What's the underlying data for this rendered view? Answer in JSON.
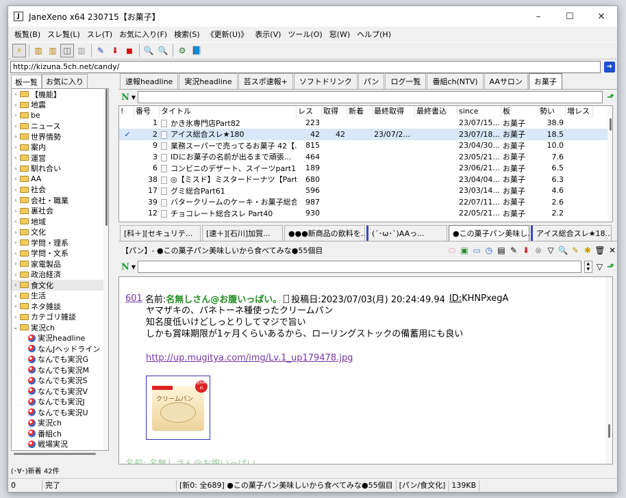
{
  "window": {
    "title": "JaneXeno x64 230715【お菓子】",
    "icon": "J"
  },
  "window_controls": {
    "minimize": "–",
    "maximize": "☐",
    "close": "✕"
  },
  "menu": [
    "板覧(B)",
    "スレ覧(L)",
    "スレ(T)",
    "お気に入り(F)",
    "検索(S)",
    "《更新(U)》",
    "表示(V)",
    "ツール(O)",
    "窓(W)",
    "ヘルプ(H)"
  ],
  "toolbar_icons": {
    "lightning": "⚡",
    "pane1": "▥",
    "pane2": "▥",
    "pane3": "◫",
    "pane4": "▥",
    "pen": "✎",
    "down": "⬇",
    "stop": "◼",
    "search1": "🔍",
    "search2": "🔍",
    "fav": "⚙",
    "book": "📘"
  },
  "url": "http://kizuna.5ch.net/candy/",
  "left_tabs": [
    "板一覧",
    "お気に入り"
  ],
  "tree": [
    {
      "label": "【機能】",
      "type": "folder",
      "arrow": "›"
    },
    {
      "label": "地震",
      "type": "folder",
      "arrow": "›"
    },
    {
      "label": "be",
      "type": "folder",
      "arrow": "›"
    },
    {
      "label": "ニュース",
      "type": "folder",
      "arrow": "›"
    },
    {
      "label": "世界情勢",
      "type": "folder",
      "arrow": "›"
    },
    {
      "label": "案内",
      "type": "folder",
      "arrow": "›"
    },
    {
      "label": "運営",
      "type": "folder",
      "arrow": "›"
    },
    {
      "label": "馴れ合い",
      "type": "folder",
      "arrow": "›"
    },
    {
      "label": "AA",
      "type": "folder",
      "arrow": "›"
    },
    {
      "label": "社会",
      "type": "folder",
      "arrow": "›"
    },
    {
      "label": "会社・職業",
      "type": "folder",
      "arrow": "›"
    },
    {
      "label": "裏社会",
      "type": "folder",
      "arrow": "›"
    },
    {
      "label": "地域",
      "type": "folder",
      "arrow": "›"
    },
    {
      "label": "文化",
      "type": "folder",
      "arrow": "›"
    },
    {
      "label": "学問・理系",
      "type": "folder",
      "arrow": "›"
    },
    {
      "label": "学問・文系",
      "type": "folder",
      "arrow": "›"
    },
    {
      "label": "家電製品",
      "type": "folder",
      "arrow": "›"
    },
    {
      "label": "政治経済",
      "type": "folder",
      "arrow": "›"
    },
    {
      "label": "食文化",
      "type": "folder",
      "arrow": "›",
      "selected": true
    },
    {
      "label": "生活",
      "type": "folder",
      "arrow": "›"
    },
    {
      "label": "ネタ雑談",
      "type": "folder",
      "arrow": "›"
    },
    {
      "label": "カテゴリ雑談",
      "type": "folder",
      "arrow": "›"
    },
    {
      "label": "実況ch",
      "type": "folder",
      "arrow": "⌄"
    },
    {
      "label": "実況headline",
      "type": "board"
    },
    {
      "label": "なんJヘッドライン",
      "type": "board"
    },
    {
      "label": "なんでも実況G",
      "type": "board"
    },
    {
      "label": "なんでも実況M",
      "type": "board"
    },
    {
      "label": "なんでも実況S",
      "type": "board"
    },
    {
      "label": "なんでも実況V",
      "type": "board"
    },
    {
      "label": "なんでも実況J",
      "type": "board"
    },
    {
      "label": "なんでも実況U",
      "type": "board"
    },
    {
      "label": "実況ch",
      "type": "board"
    },
    {
      "label": "番組ch",
      "type": "board"
    },
    {
      "label": "戦場実況",
      "type": "board"
    }
  ],
  "board_tabs": [
    "速報headline",
    "実況headline",
    "芸スポ速報+",
    "ソフトドリンク",
    "パン",
    "ログ一覧",
    "番組ch(NTV)",
    "AAサロン",
    "お菓子"
  ],
  "active_board_tab": 8,
  "filter_n": "N",
  "list_headers": [
    "!",
    "番号",
    "タイトル",
    "レス",
    "取得",
    "新着",
    "最終取得",
    "最終書込",
    "since",
    "板",
    "勢い",
    "増レス"
  ],
  "threads": [
    {
      "mark": "",
      "no": "1",
      "title": "かき氷専門店Part82",
      "res": "223",
      "got": "",
      "new": "",
      "last_get": "",
      "last_post": "",
      "since": "23/07/15...",
      "board": "お菓子",
      "force": "38.9",
      "inc": ""
    },
    {
      "mark": "✓",
      "no": "2",
      "title": "アイス総合スレ★180",
      "res": "42",
      "got": "42",
      "new": "",
      "last_get": "23/07/2...",
      "last_post": "",
      "since": "23/07/18...",
      "board": "お菓子",
      "force": "18.5",
      "inc": "",
      "selected": true
    },
    {
      "mark": "",
      "no": "9",
      "title": "業務スーパーで売ってるお菓子 42【...",
      "res": "815",
      "got": "",
      "new": "",
      "last_get": "",
      "last_post": "",
      "since": "23/04/30...",
      "board": "お菓子",
      "force": "10.0",
      "inc": ""
    },
    {
      "mark": "",
      "no": "3",
      "title": "IDにお菓子の名前が出るまで頑張...",
      "res": "464",
      "got": "",
      "new": "",
      "last_get": "",
      "last_post": "",
      "since": "23/05/21...",
      "board": "お菓子",
      "force": "7.6",
      "inc": ""
    },
    {
      "mark": "",
      "no": "6",
      "title": "コンビニのデザート、スイーツpart161",
      "res": "189",
      "got": "",
      "new": "",
      "last_get": "",
      "last_post": "",
      "since": "23/06/21...",
      "board": "お菓子",
      "force": "6.5",
      "inc": ""
    },
    {
      "mark": "",
      "no": "38",
      "title": "◎【ミスド】ミスタードーナツ【Part173...",
      "res": "680",
      "got": "",
      "new": "",
      "last_get": "",
      "last_post": "",
      "since": "23/04/04...",
      "board": "お菓子",
      "force": "6.3",
      "inc": ""
    },
    {
      "mark": "",
      "no": "17",
      "title": "グミ総合Part61",
      "res": "596",
      "got": "",
      "new": "",
      "last_get": "",
      "last_post": "",
      "since": "23/03/14...",
      "board": "お菓子",
      "force": "4.6",
      "inc": ""
    },
    {
      "mark": "",
      "no": "39",
      "title": "バタークリームのケーキ・お菓子総合...",
      "res": "987",
      "got": "",
      "new": "",
      "last_get": "",
      "last_post": "",
      "since": "22/07/11...",
      "board": "お菓子",
      "force": "2.6",
      "inc": ""
    },
    {
      "mark": "",
      "no": "12",
      "title": "チョコレート総合スレ Part40",
      "res": "930",
      "got": "",
      "new": "",
      "last_get": "",
      "last_post": "",
      "since": "22/05/21...",
      "board": "お菓子",
      "force": "2.2",
      "inc": ""
    }
  ],
  "thread_tabs": [
    "[科＋][セキュリテ...",
    "[速＋][石川]加賀...",
    "●●●新商品の飲料を...",
    "(´･ω･`)AAっ...",
    "●この菓子パン美味し...",
    "アイス総合スレ★18..."
  ],
  "active_thread_tab": 4,
  "thread_title": "【パン】- ●この菓子パン美味しいから食べてみな●55個目",
  "view_icons": [
    "⬭",
    "▣",
    "▭",
    "◷",
    "▤",
    "✎",
    "⬇",
    "⊗",
    "▽",
    "🔍",
    "✎",
    "✱",
    "🗑",
    "✕"
  ],
  "post": {
    "number": "601",
    "name_label": "名前:",
    "name": "名無しさん@お腹いっぱい。",
    "date_label": "投稿日:",
    "date": "2023/07/03(月) 20:24:49.94",
    "id_label": "ID:",
    "id": "KHNPxegA",
    "lines": [
      "ヤマザキの、パネトーネ種使ったクリームパン",
      "知名度低いけどしっとりしてマジで旨い",
      "しかも賞味期限が1ヶ月くらいあるから、ローリングストックの備蓄用にも良い"
    ],
    "link": "http://up.mugitya.com/img/Lv.1_up179478.jpg",
    "image_text": "クリームパン",
    "image_badge": "送料無料"
  },
  "next_post_partial": "名前: 名無しさん@お腹いっぱい。",
  "status_top": "(･∀･)新着 42件",
  "status": [
    "0",
    "完了",
    "[新0: 全689] ●この菓子パン美味しいから食べてみな●55個目",
    "[パン/食文化]",
    "139KB"
  ]
}
